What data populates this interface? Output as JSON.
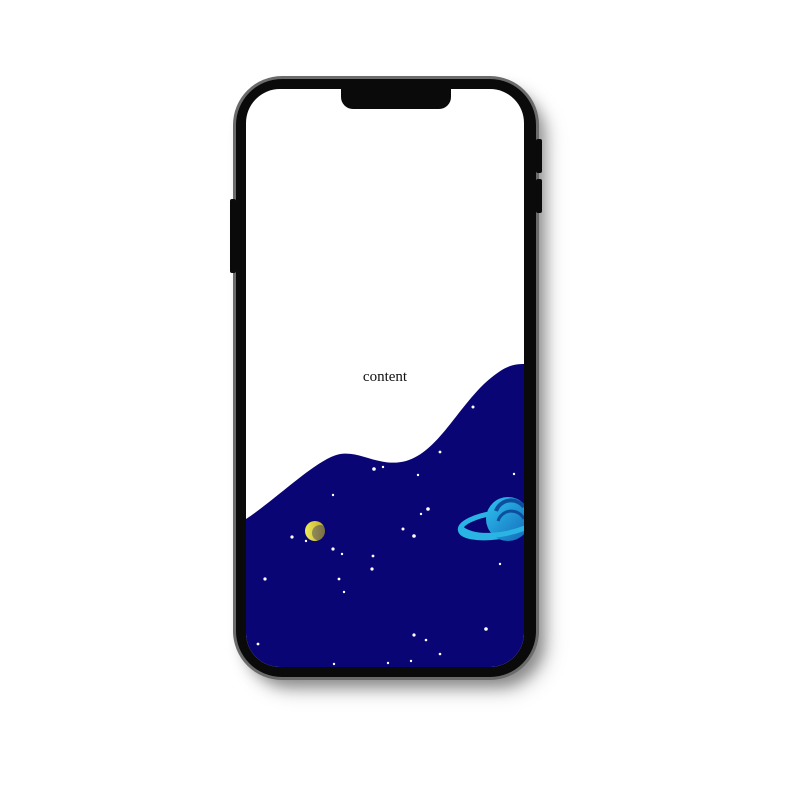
{
  "screen": {
    "content_label": "content"
  },
  "colors": {
    "space_bg": "#0a0575",
    "star": "#ffffff",
    "moon": "#e6e047",
    "planet_ring": "#29b6e6",
    "planet_body": "#1f8fd8"
  },
  "icons": {
    "moon": "moon-icon",
    "planet": "planet-icon"
  }
}
